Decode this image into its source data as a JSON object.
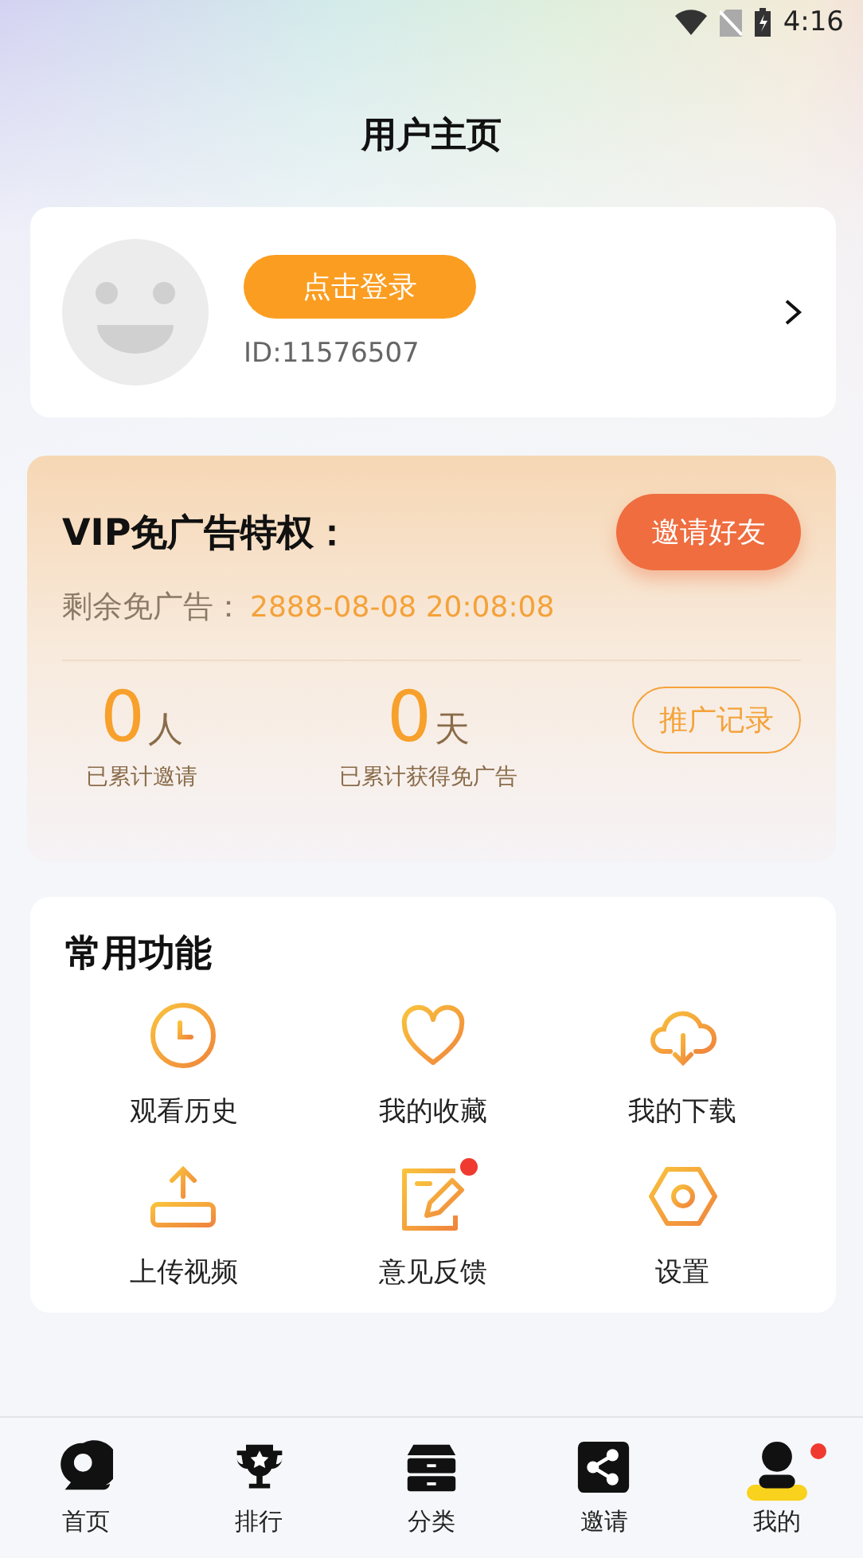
{
  "status_bar": {
    "time": "4:16"
  },
  "title": "用户主页",
  "profile": {
    "login_button": "点击登录",
    "user_id": "ID:11576507"
  },
  "vip": {
    "title": "VIP免广告特权：",
    "invite_button": "邀请好友",
    "remaining_label": "剩余免广告：",
    "remaining_value": "2888-08-08 20:08:08",
    "records_button": "推广记录",
    "stats": [
      {
        "value": "0",
        "unit": "人",
        "label": "已累计邀请"
      },
      {
        "value": "0",
        "unit": "天",
        "label": "已累计获得免广告"
      }
    ]
  },
  "functions": {
    "title": "常用功能",
    "items": [
      {
        "kind": "history",
        "label": "观看历史",
        "badge": false
      },
      {
        "kind": "favorites",
        "label": "我的收藏",
        "badge": false
      },
      {
        "kind": "download",
        "label": "我的下载",
        "badge": false
      },
      {
        "kind": "upload",
        "label": "上传视频",
        "badge": false
      },
      {
        "kind": "feedback",
        "label": "意见反馈",
        "badge": true
      },
      {
        "kind": "settings",
        "label": "设置",
        "badge": false
      }
    ]
  },
  "tab_bar": [
    {
      "kind": "home",
      "label": "首页",
      "selected": false,
      "badge": false
    },
    {
      "kind": "ranking",
      "label": "排行",
      "selected": false,
      "badge": false
    },
    {
      "kind": "category",
      "label": "分类",
      "selected": false,
      "badge": false
    },
    {
      "kind": "invite",
      "label": "邀请",
      "selected": false,
      "badge": false
    },
    {
      "kind": "mine",
      "label": "我的",
      "selected": true,
      "badge": true
    }
  ]
}
